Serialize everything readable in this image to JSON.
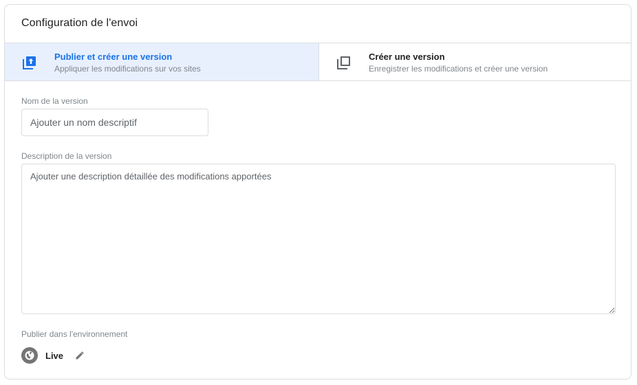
{
  "card": {
    "title": "Configuration de l'envoi"
  },
  "tabs": [
    {
      "title": "Publier et créer une version",
      "subtitle": "Appliquer les modifications sur vos sites",
      "icon": "publish-icon",
      "active": true
    },
    {
      "title": "Créer une version",
      "subtitle": "Enregistrer les modifications et créer une version",
      "icon": "version-icon",
      "active": false
    }
  ],
  "version_name": {
    "label": "Nom de la version",
    "placeholder": "Ajouter un nom descriptif",
    "value": ""
  },
  "version_description": {
    "label": "Description de la version",
    "placeholder": "Ajouter une description détaillée des modifications apportées",
    "value": ""
  },
  "environment": {
    "label": "Publier dans l'environnement",
    "name": "Live",
    "icon": "globe-icon",
    "edit_icon": "pencil-icon"
  },
  "colors": {
    "accent": "#1a73e8",
    "active_tab_bg": "#e8f0fe",
    "border": "#dadce0",
    "muted_text": "#80868b"
  }
}
